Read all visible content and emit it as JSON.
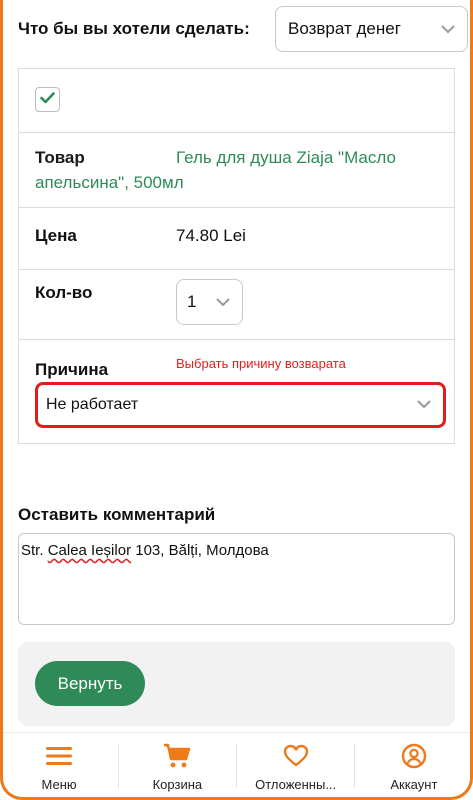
{
  "action": {
    "label": "Что бы вы хотели сделать:",
    "selected": "Возврат денег"
  },
  "item": {
    "checked": true,
    "product_label": "Товар",
    "product_name": "Гель для душа Ziaja \"Масло апельсина\", 500мл",
    "price_label": "Цена",
    "price_value": "74.80 Lei",
    "qty_label": "Кол-во",
    "qty_value": "1",
    "reason_label": "Причина",
    "reason_hint": "Выбрать причину возварата",
    "reason_value": "Не работает"
  },
  "comment": {
    "label": "Оставить комментарий",
    "text_a": "Str. ",
    "text_b": "Calea Ieșilor",
    "text_c": " 103, Bălți, Молдова"
  },
  "actions": {
    "return_label": "Вернуть"
  },
  "colors": {
    "accent": "#ef7a1a",
    "brand_green": "#2e8b57",
    "error_red": "#e21b1b"
  },
  "tabbar": {
    "items": [
      {
        "label": "Меню",
        "icon": "menu-icon"
      },
      {
        "label": "Корзина",
        "icon": "cart-icon"
      },
      {
        "label": "Отложенны...",
        "icon": "heart-icon"
      },
      {
        "label": "Аккаунт",
        "icon": "account-icon"
      }
    ]
  }
}
